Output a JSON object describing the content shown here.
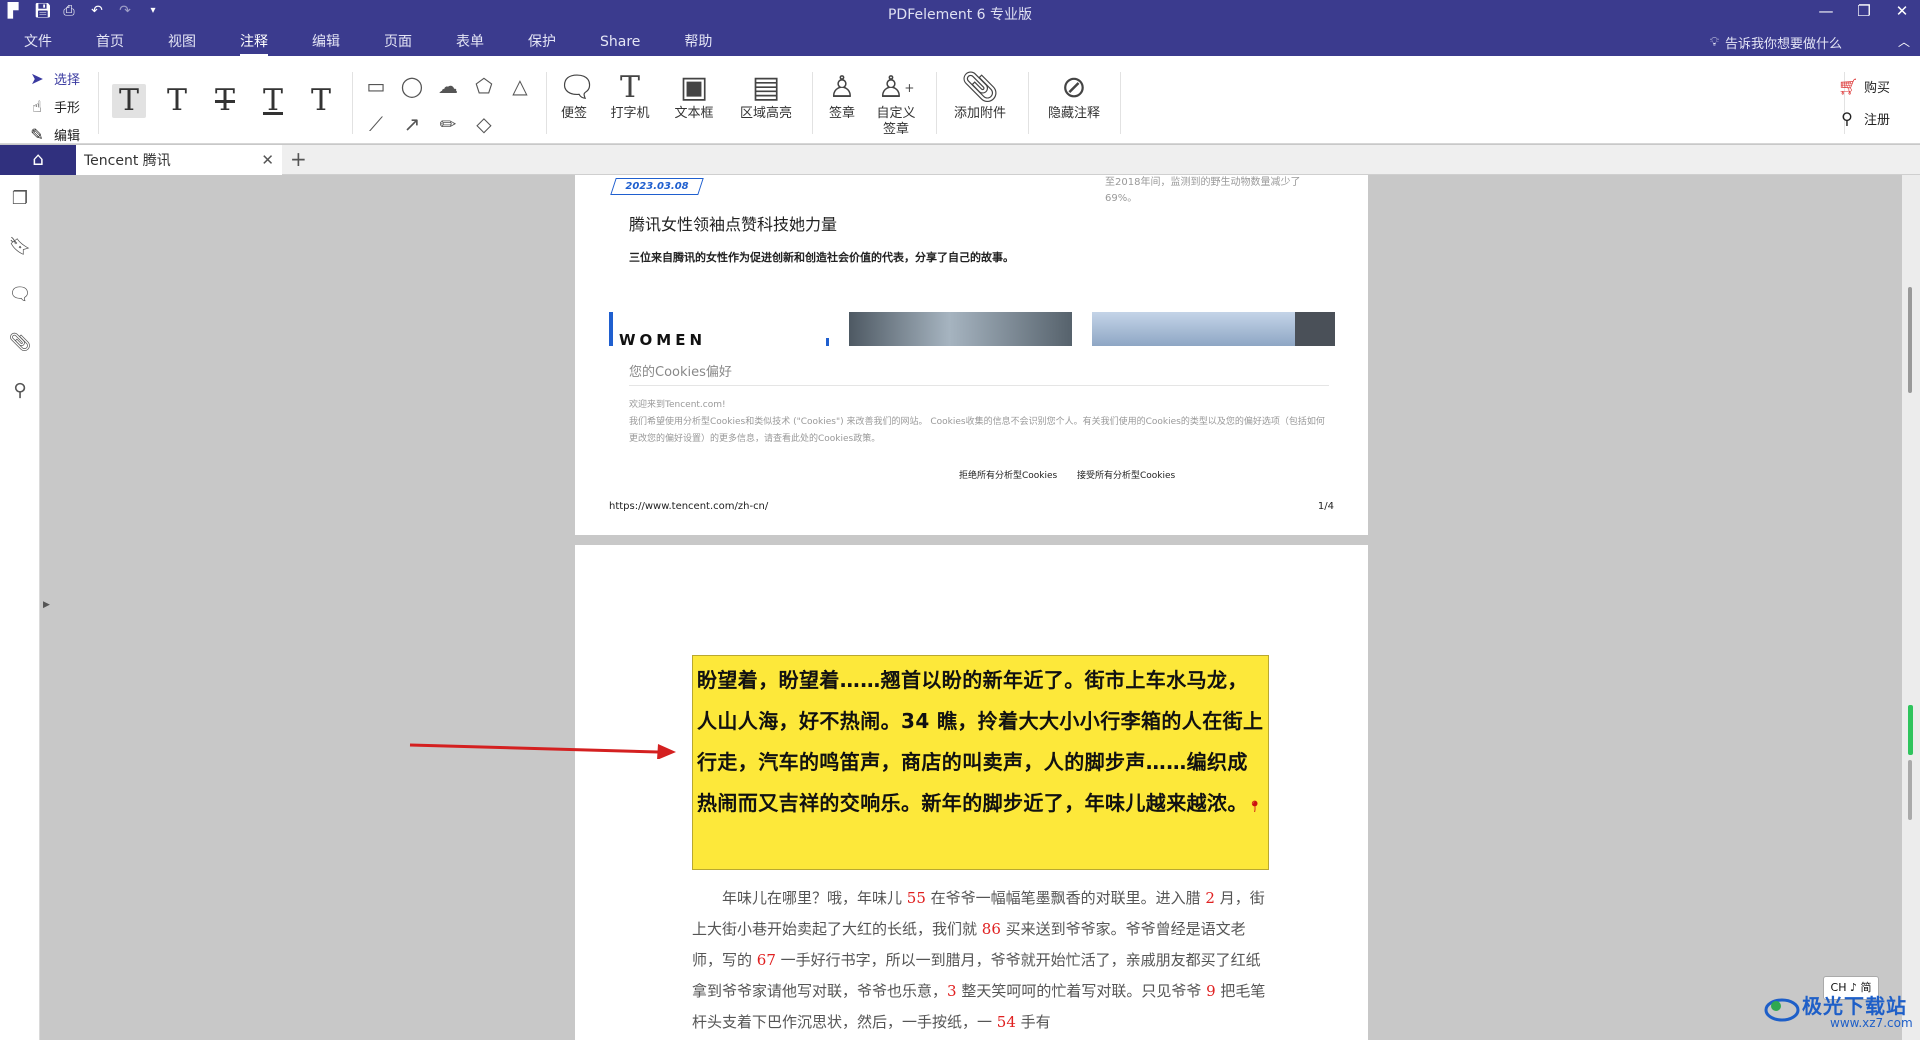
{
  "app": {
    "title": "PDFelement  6 专业版",
    "quick_access_icons": [
      "app-logo-icon",
      "save-icon",
      "print-icon",
      "undo-icon",
      "redo-icon",
      "customize-icon"
    ]
  },
  "menu": {
    "items": [
      "文件",
      "首页",
      "视图",
      "注释",
      "编辑",
      "页面",
      "表单",
      "保护",
      "Share",
      "帮助"
    ],
    "active": "注释",
    "tell_me": "告诉我你想要做什么"
  },
  "ribbon": {
    "modes": [
      {
        "label": "选择",
        "icon": "cursor-icon"
      },
      {
        "label": "手形",
        "icon": "hand-icon"
      },
      {
        "label": "编辑",
        "icon": "edit-icon"
      }
    ],
    "text_style_glyph": "T",
    "tools": [
      {
        "label": "便签",
        "icon": "sticky-note-icon"
      },
      {
        "label": "打字机",
        "icon": "typewriter-icon"
      },
      {
        "label": "文本框",
        "icon": "textbox-icon"
      },
      {
        "label": "区域高亮",
        "icon": "area-highlight-icon"
      },
      {
        "label": "签章",
        "icon": "stamp-icon"
      },
      {
        "label": "自定义\n签章",
        "icon": "custom-stamp-icon"
      },
      {
        "label": "添加附件",
        "icon": "attachment-icon"
      },
      {
        "label": "隐藏注释",
        "icon": "hide-annotation-icon"
      }
    ],
    "right": [
      {
        "label": "购买",
        "icon": "cart-icon"
      },
      {
        "label": "注册",
        "icon": "key-icon"
      }
    ]
  },
  "tabs": {
    "document": "Tencent 腾讯"
  },
  "page1": {
    "date": "2023.03.08",
    "side_text": "至2018年间，监测到的野生动物数量减少了69%。",
    "title": "腾讯女性领袖点赞科技她力量",
    "subtitle": "三位来自腾讯的女性作为促进创新和创造社会价值的代表，分享了自己的故事。",
    "image_caption": "WOMEN",
    "cookie_title": "您的Cookies偏好",
    "cookie_text": "欢迎来到Tencent.com!\n我们希望使用分析型Cookies和类似技术 (\"Cookies\") 来改善我们的网站。 Cookies收集的信息不会识别您个人。有关我们使用的Cookies的类型以及您的偏好选项（包括如何更改您的偏好设置）的更多信息，请查看此处的Cookies政策。",
    "reject_btn": "拒绝所有分析型Cookies",
    "accept_btn": "接受所有分析型Cookies",
    "footer_url": "https://www.tencent.com/zh-cn/",
    "page_num": "1/4"
  },
  "page2": {
    "highlight_text": "盼望着，盼望着……翘首以盼的新年近了。街市上车水马龙，人山人海，好不热闹。34 瞧，拎着大大小小行李箱的人在街上行走，汽车的鸣笛声，商店的叫卖声，人的脚步声……编织成热闹而又吉祥的交响乐。新年的脚步近了，年味儿越来越浓。",
    "body": [
      {
        "t": "年味儿在哪里？哦，年味儿 "
      },
      {
        "n": "55"
      },
      {
        "t": " 在爷爷一幅幅笔墨飘香的对联里。进入腊 "
      },
      {
        "n": "2"
      },
      {
        "t": " 月，街上大街小巷开始卖起了大红的长纸，我们就 "
      },
      {
        "n": "86"
      },
      {
        "t": " 买来送到爷爷家。爷爷曾经是语文老师，写的 "
      },
      {
        "n": "67"
      },
      {
        "t": " 一手好行书字，所以一到腊月，爷爷就开始忙活了，亲戚朋友都买了红纸拿到爷爷家请他写对联，爷爷也乐意，"
      },
      {
        "n": "3"
      },
      {
        "t": " 整天笑呵呵的忙着写对联。只见爷爷 "
      },
      {
        "n": "9"
      },
      {
        "t": " 把毛笔杆头支着下巴作沉思状，然后，一手按纸，一 "
      },
      {
        "n": "54"
      },
      {
        "t": " 手有"
      }
    ]
  },
  "status": {
    "ime": "CH ♪ 简"
  },
  "watermark": {
    "text": "极光下载站",
    "url": "www.xz7.com"
  },
  "colors": {
    "title_bar": "#3b3b8e",
    "highlight": "#fde83a",
    "arrow": "#d42020",
    "number_red": "#e02020",
    "accent_blue": "#1f5fcf"
  }
}
